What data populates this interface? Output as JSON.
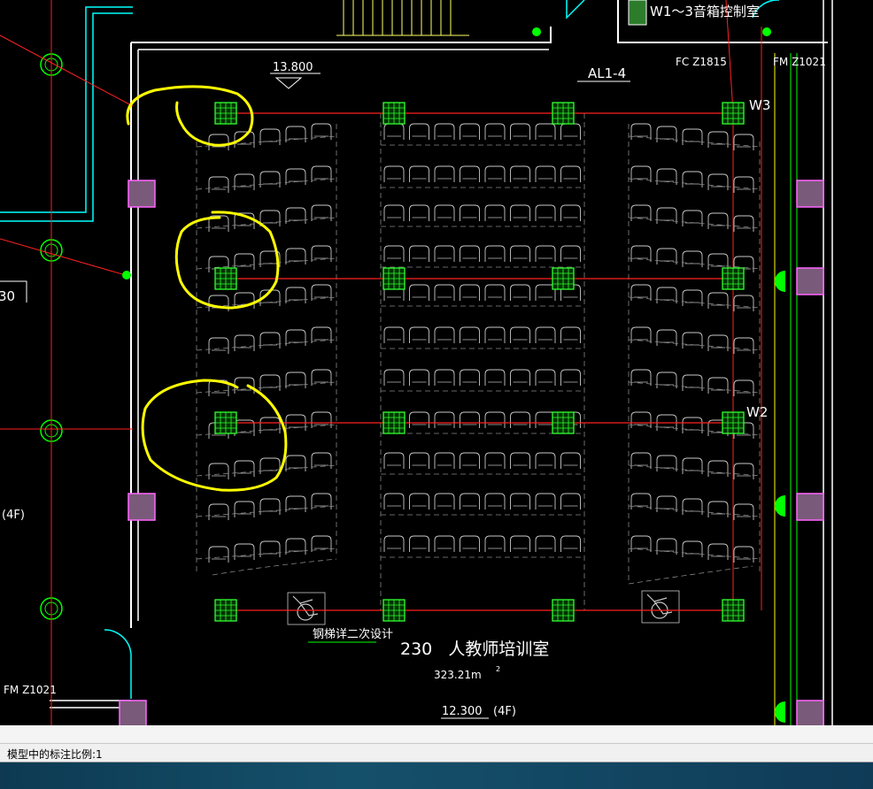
{
  "drawing": {
    "room_title": "230   人教师培训室",
    "room_area": "323.21m",
    "room_area_sup": "2",
    "elevation_top": "13.800",
    "elevation_bottom": "12.300",
    "floor_label_bottom": "(4F)",
    "floor_label_left": "(4F)",
    "panel_label": "AL1-4",
    "control_room": "W1～3音箱控制室",
    "fc_label": "FC Z1815",
    "fm_label_right": "FM Z1021",
    "fm_label_left": "FM Z1021",
    "w3_label": "W3",
    "w2_label": "W2",
    "stair_note": "钢梯详二次设计",
    "left_partial_label": "30"
  },
  "status_bar": {
    "text": "模型中的标注比例:1"
  },
  "colors": {
    "background": "#000000",
    "wall": "#ffffff",
    "seat": "#c8c8c8",
    "column": "#ff66ff",
    "fixture": "#33ff33",
    "line_red": "#ff2020",
    "annotation": "#ffff00",
    "cyan": "#00ffff"
  }
}
